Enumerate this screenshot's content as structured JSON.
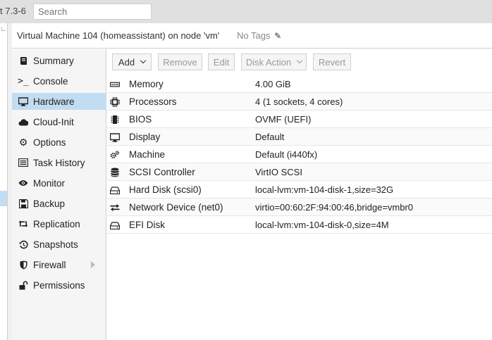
{
  "topbar": {
    "version_text": "t 7.3-6",
    "search_placeholder": "Search"
  },
  "panel": {
    "title": "Virtual Machine 104 (homeassistant) on node 'vm'",
    "tags_label": "No Tags"
  },
  "sidebar": {
    "items": [
      {
        "label": "Summary",
        "icon": "book-icon",
        "active": false
      },
      {
        "label": "Console",
        "icon": "terminal-icon",
        "active": false
      },
      {
        "label": "Hardware",
        "icon": "desktop-icon",
        "active": true
      },
      {
        "label": "Cloud-Init",
        "icon": "cloud-icon",
        "active": false
      },
      {
        "label": "Options",
        "icon": "gear-icon",
        "active": false
      },
      {
        "label": "Task History",
        "icon": "list-icon",
        "active": false
      },
      {
        "label": "Monitor",
        "icon": "eye-icon",
        "active": false
      },
      {
        "label": "Backup",
        "icon": "floppy-icon",
        "active": false
      },
      {
        "label": "Replication",
        "icon": "retweet-icon",
        "active": false
      },
      {
        "label": "Snapshots",
        "icon": "history-icon",
        "active": false
      },
      {
        "label": "Firewall",
        "icon": "shield-icon",
        "active": false,
        "has_submenu": true
      },
      {
        "label": "Permissions",
        "icon": "unlock-icon",
        "active": false
      }
    ]
  },
  "toolbar": {
    "add_label": "Add",
    "remove_label": "Remove",
    "edit_label": "Edit",
    "disk_action_label": "Disk Action",
    "revert_label": "Revert"
  },
  "hardware": {
    "rows": [
      {
        "name": "Memory",
        "value": "4.00 GiB",
        "icon": "memory-icon"
      },
      {
        "name": "Processors",
        "value": "4 (1 sockets, 4 cores)",
        "icon": "cpu-icon"
      },
      {
        "name": "BIOS",
        "value": "OVMF (UEFI)",
        "icon": "chip-icon"
      },
      {
        "name": "Display",
        "value": "Default",
        "icon": "monitor-icon"
      },
      {
        "name": "Machine",
        "value": "Default (i440fx)",
        "icon": "cogs-icon"
      },
      {
        "name": "SCSI Controller",
        "value": "VirtIO SCSI",
        "icon": "database-icon"
      },
      {
        "name": "Hard Disk (scsi0)",
        "value": "local-lvm:vm-104-disk-1,size=32G",
        "icon": "hdd-icon"
      },
      {
        "name": "Network Device (net0)",
        "value": "virtio=00:60:2F:94:00:46,bridge=vmbr0",
        "icon": "exchange-icon"
      },
      {
        "name": "EFI Disk",
        "value": "local-lvm:vm-104-disk-0,size=4M",
        "icon": "hdd-icon"
      }
    ]
  }
}
